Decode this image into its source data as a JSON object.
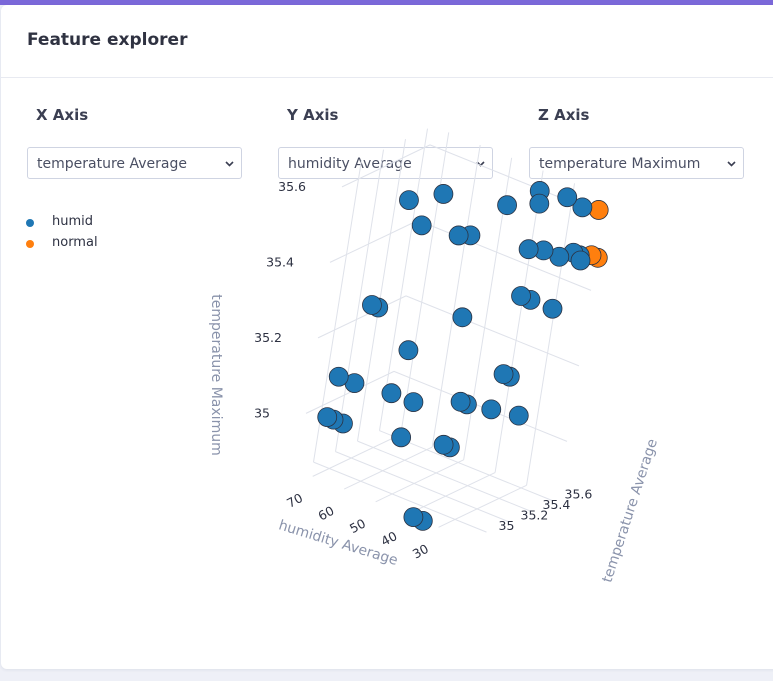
{
  "header": {
    "title": "Feature explorer"
  },
  "controls": {
    "x": {
      "label": "X Axis",
      "value": "temperature Average"
    },
    "y": {
      "label": "Y Axis",
      "value": "humidity Average"
    },
    "z": {
      "label": "Z Axis",
      "value": "temperature Maximum"
    }
  },
  "legend": [
    {
      "name": "humid",
      "color": "#1f77b4"
    },
    {
      "name": "normal",
      "color": "#ff7f0e"
    }
  ],
  "chart_data": {
    "type": "scatter",
    "x_title": "temperature Average",
    "y_title": "humidity Average",
    "z_title": "temperature Maximum",
    "x_ticks": [
      "35",
      "35.2",
      "35.4",
      "35.6"
    ],
    "y_ticks": [
      "70",
      "60",
      "50",
      "40",
      "30"
    ],
    "z_ticks": [
      "35",
      "35.2",
      "35.4",
      "35.6"
    ],
    "series": [
      {
        "name": "humid",
        "color": "#1f77b4",
        "points": [
          [
            35.2,
            55,
            35.6
          ],
          [
            35.2,
            65,
            35.55
          ],
          [
            35.35,
            40,
            35.6
          ],
          [
            35.5,
            35,
            35.6
          ],
          [
            35.6,
            30,
            35.62
          ],
          [
            35.6,
            25,
            35.61
          ],
          [
            35.55,
            37,
            35.62
          ],
          [
            35.2,
            60,
            35.5
          ],
          [
            35.25,
            50,
            35.5
          ],
          [
            35.3,
            48,
            35.5
          ],
          [
            35.4,
            33,
            35.5
          ],
          [
            35.45,
            30,
            35.5
          ],
          [
            35.45,
            25,
            35.5
          ],
          [
            35.55,
            22,
            35.5
          ],
          [
            35.5,
            20,
            35.5
          ],
          [
            35.55,
            24,
            35.5
          ],
          [
            35.3,
            30,
            35.4
          ],
          [
            35.3,
            27,
            35.4
          ],
          [
            35.3,
            20,
            35.4
          ],
          [
            35.0,
            65,
            35.3
          ],
          [
            35.0,
            63,
            35.3
          ],
          [
            35.25,
            45,
            35.3
          ],
          [
            35.1,
            55,
            35.2
          ],
          [
            35.25,
            30,
            35.2
          ],
          [
            35.25,
            28,
            35.2
          ],
          [
            34.95,
            70,
            35.1
          ],
          [
            34.95,
            65,
            35.1
          ],
          [
            35.0,
            55,
            35.1
          ],
          [
            35.0,
            48,
            35.1
          ],
          [
            35.2,
            40,
            35.1
          ],
          [
            35.2,
            38,
            35.1
          ],
          [
            35.25,
            32,
            35.1
          ],
          [
            35.3,
            25,
            35.1
          ],
          [
            34.9,
            70,
            35.0
          ],
          [
            34.9,
            68,
            35.0
          ],
          [
            34.9,
            65,
            35.0
          ],
          [
            35.0,
            50,
            35.0
          ],
          [
            35.1,
            40,
            35.0
          ],
          [
            35.1,
            38,
            35.0
          ],
          [
            34.85,
            38,
            34.85
          ],
          [
            34.85,
            35,
            34.85
          ]
        ]
      },
      {
        "name": "normal",
        "color": "#ff7f0e",
        "points": [
          [
            35.6,
            20,
            35.62
          ],
          [
            35.6,
            20,
            35.5
          ],
          [
            35.6,
            18,
            35.5
          ]
        ]
      }
    ]
  }
}
